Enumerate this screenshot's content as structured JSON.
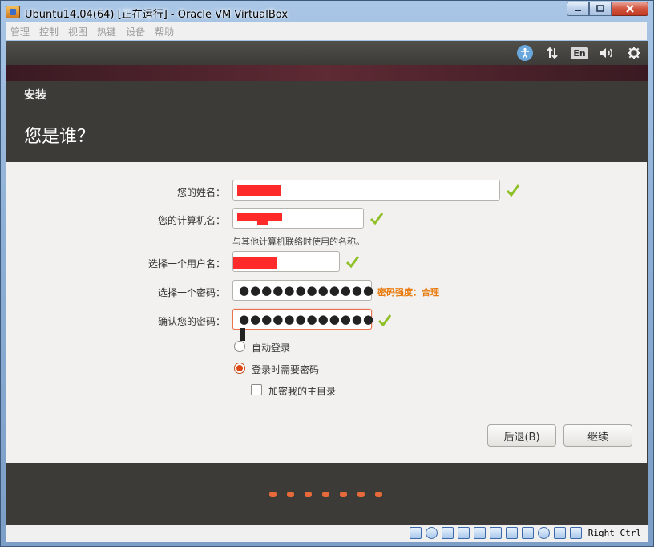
{
  "window": {
    "title": "Ubuntu14.04(64) [正在运行] - Oracle VM VirtualBox"
  },
  "menubar": {
    "items": [
      "管理",
      "控制",
      "视图",
      "热键",
      "设备",
      "帮助"
    ]
  },
  "tray": {
    "language": "En"
  },
  "dialog": {
    "title": "安装",
    "heading": "您是谁？",
    "fields": {
      "name_label": "您的姓名：",
      "computer_label": "您的计算机名：",
      "computer_hint": "与其他计算机联络时使用的名称。",
      "username_label": "选择一个用户名：",
      "password_label": "选择一个密码：",
      "password_value": "●●●●●●●●●●●●",
      "password_strength": "密码强度：合理",
      "confirm_label": "确认您的密码：",
      "confirm_value": "●●●●●●●●●●●●"
    },
    "options": {
      "auto_login": "自动登录",
      "require_password": "登录时需要密码",
      "encrypt_home": "加密我的主目录"
    },
    "selected_login_option": "require_password",
    "encrypt_home_checked": false,
    "buttons": {
      "back": "后退(B)",
      "continue": "继续"
    },
    "progress_dots": 7
  },
  "statusbar": {
    "host_key": "Right Ctrl"
  },
  "colors": {
    "accent": "#dd4814",
    "check": "#8fbf26",
    "strength": "#e87a0a"
  }
}
